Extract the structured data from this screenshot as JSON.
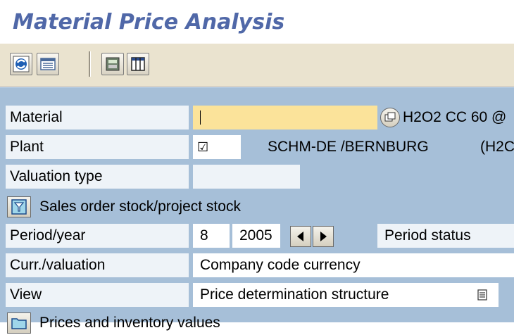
{
  "title": "Material Price Analysis",
  "toolbar": {
    "buttons": [
      {
        "icon": "refresh-icon"
      },
      {
        "icon": "list-icon"
      },
      {
        "icon": "hierarchy-icon"
      },
      {
        "icon": "table-icon"
      }
    ]
  },
  "form": {
    "material": {
      "label": "Material",
      "value": "",
      "description": "H2O2 CC 60 @"
    },
    "plant": {
      "label": "Plant",
      "checkbox": "☑",
      "description": "SCHM-DE /BERNBURG",
      "extra": "(H2C"
    },
    "valuation_type": {
      "label": "Valuation type",
      "value": ""
    },
    "sales_order": {
      "label": "Sales order stock/project stock"
    },
    "period_year": {
      "label": "Period/year",
      "period": "8",
      "year": "2005",
      "status_label": "Period status"
    },
    "curr_valuation": {
      "label": "Curr./valuation",
      "value": "Company code currency"
    },
    "view": {
      "label": "View",
      "value": "Price determination structure"
    },
    "prices": {
      "label": "Prices and inventory values"
    }
  },
  "colors": {
    "title": "#5068a8",
    "toolbar_bg": "#eae3cf",
    "form_bg": "#a6bfd8",
    "label_bg": "#eef3f8",
    "required_field": "#fbe39a"
  }
}
